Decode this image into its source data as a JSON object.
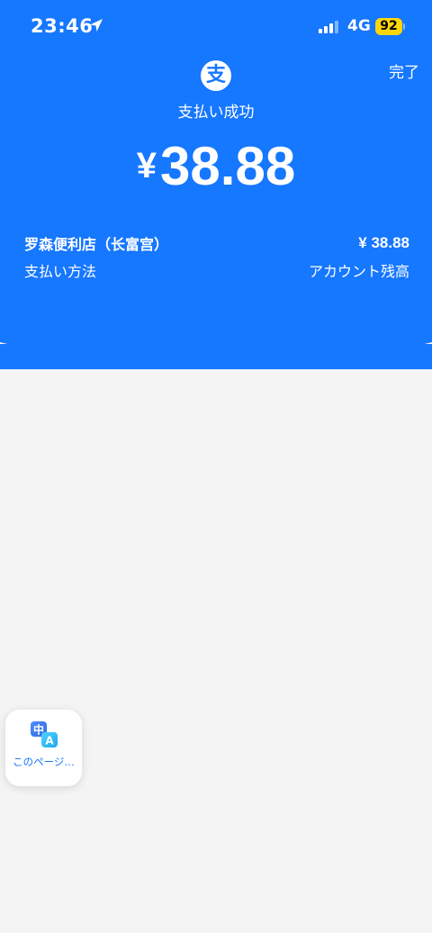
{
  "status_bar": {
    "time": "23:46",
    "network": "4G",
    "battery": "92",
    "icons": [
      "location-arrow-icon",
      "signal-icon",
      "battery-icon"
    ]
  },
  "header": {
    "done_label": "完了",
    "brand_glyph": "支",
    "title": "支払い成功",
    "currency_symbol": "¥",
    "amount": "38.88"
  },
  "details": {
    "merchant": "罗森便利店（长富宫）",
    "merchant_amount": "¥ 38.88",
    "method_label": "支払い方法",
    "method_value": "アカウント残高"
  },
  "translate_widget": {
    "icon_glyph_zh": "中",
    "icon_glyph_en": "A",
    "label": "このページ…"
  },
  "colors": {
    "brand_blue": "#1677ff",
    "background": "#f4f4f4",
    "battery": "#ffd60a"
  }
}
